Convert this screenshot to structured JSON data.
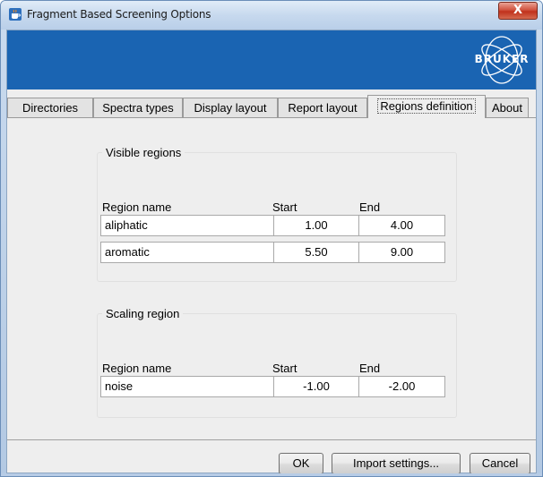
{
  "window": {
    "title": "Fragment Based Screening Options",
    "close_label": "X",
    "icon": "java-cup-icon"
  },
  "banner": {
    "logo_text": "BRUKER",
    "color": "#1a64b2"
  },
  "tabs": [
    {
      "label": "Directories",
      "active": false
    },
    {
      "label": "Spectra types",
      "active": false
    },
    {
      "label": "Display layout",
      "active": false
    },
    {
      "label": "Report layout",
      "active": false
    },
    {
      "label": "Regions definition",
      "active": true
    },
    {
      "label": "About",
      "active": false
    }
  ],
  "visible_regions": {
    "legend": "Visible regions",
    "headers": {
      "name": "Region name",
      "start": "Start",
      "end": "End"
    },
    "rows": [
      {
        "name": "aliphatic",
        "start": "1.00",
        "end": "4.00"
      },
      {
        "name": "aromatic",
        "start": "5.50",
        "end": "9.00"
      }
    ]
  },
  "scaling_region": {
    "legend": "Scaling region",
    "headers": {
      "name": "Region name",
      "start": "Start",
      "end": "End"
    },
    "rows": [
      {
        "name": "noise",
        "start": "-1.00",
        "end": "-2.00"
      }
    ]
  },
  "buttons": {
    "ok": "OK",
    "import": "Import settings...",
    "cancel": "Cancel"
  }
}
